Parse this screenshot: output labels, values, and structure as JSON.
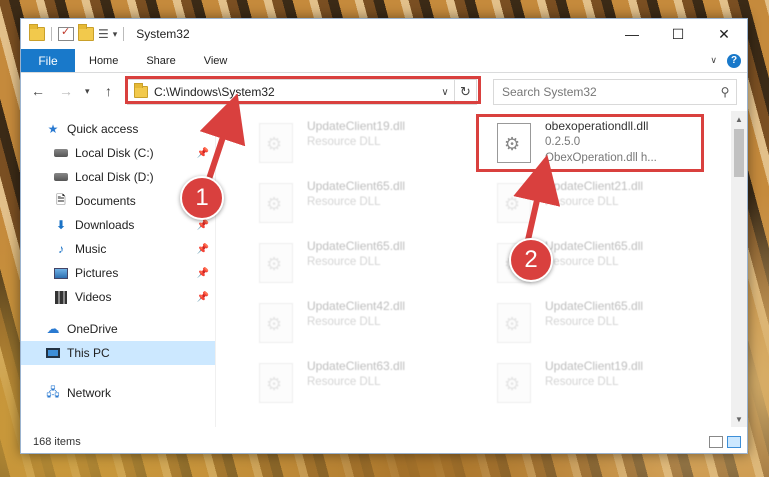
{
  "titlebar": {
    "title": "System32",
    "minimize": "—",
    "maximize": "☐",
    "close": "✕"
  },
  "ribbon": {
    "tabs": [
      "File",
      "Home",
      "Share",
      "View"
    ],
    "expand_icon": "chevron-down-icon",
    "help_icon": "help-icon"
  },
  "nav": {
    "address": "C:\\Windows\\System32",
    "search_placeholder": "Search System32"
  },
  "sidebar": {
    "items": [
      {
        "label": "Quick access",
        "icon": "star-icon",
        "pinned": false
      },
      {
        "label": "Local Disk (C:)",
        "icon": "drive-icon",
        "pinned": true
      },
      {
        "label": "Local Disk (D:)",
        "icon": "drive-icon",
        "pinned": false
      },
      {
        "label": "Documents",
        "icon": "documents-icon",
        "pinned": true
      },
      {
        "label": "Downloads",
        "icon": "downloads-icon",
        "pinned": true
      },
      {
        "label": "Music",
        "icon": "music-icon",
        "pinned": true
      },
      {
        "label": "Pictures",
        "icon": "pictures-icon",
        "pinned": true
      },
      {
        "label": "Videos",
        "icon": "videos-icon",
        "pinned": true
      },
      {
        "label": "OneDrive",
        "icon": "onedrive-icon",
        "pinned": false
      },
      {
        "label": "This PC",
        "icon": "pc-icon",
        "pinned": false,
        "selected": true
      },
      {
        "label": "Network",
        "icon": "network-icon",
        "pinned": false
      }
    ]
  },
  "files": [
    {
      "name": "UpdateClient19.dll",
      "desc": "Resource DLL"
    },
    {
      "name": "obexoperationdll.dll",
      "desc": "0.2.5.0",
      "desc2": "ObexOperation.dll h...",
      "focus": true
    },
    {
      "name": "UpdateClient65.dll",
      "desc": "Resource DLL"
    },
    {
      "name": "UpdateClient21.dll",
      "desc": "Resource DLL"
    },
    {
      "name": "UpdateClient65.dll",
      "desc": "Resource DLL"
    },
    {
      "name": "UpdateClient65.dll",
      "desc": "Resource DLL"
    },
    {
      "name": "UpdateClient42.dll",
      "desc": "Resource DLL"
    },
    {
      "name": "UpdateClient65.dll",
      "desc": "Resource DLL"
    },
    {
      "name": "UpdateClient63.dll",
      "desc": "Resource DLL"
    },
    {
      "name": "UpdateClient19.dll",
      "desc": "Resource DLL"
    }
  ],
  "status": {
    "item_count": "168 items"
  },
  "markers": {
    "m1": "1",
    "m2": "2"
  },
  "colors": {
    "accent": "#1979ca",
    "highlight": "#d9403e",
    "selected": "#cce8ff"
  }
}
